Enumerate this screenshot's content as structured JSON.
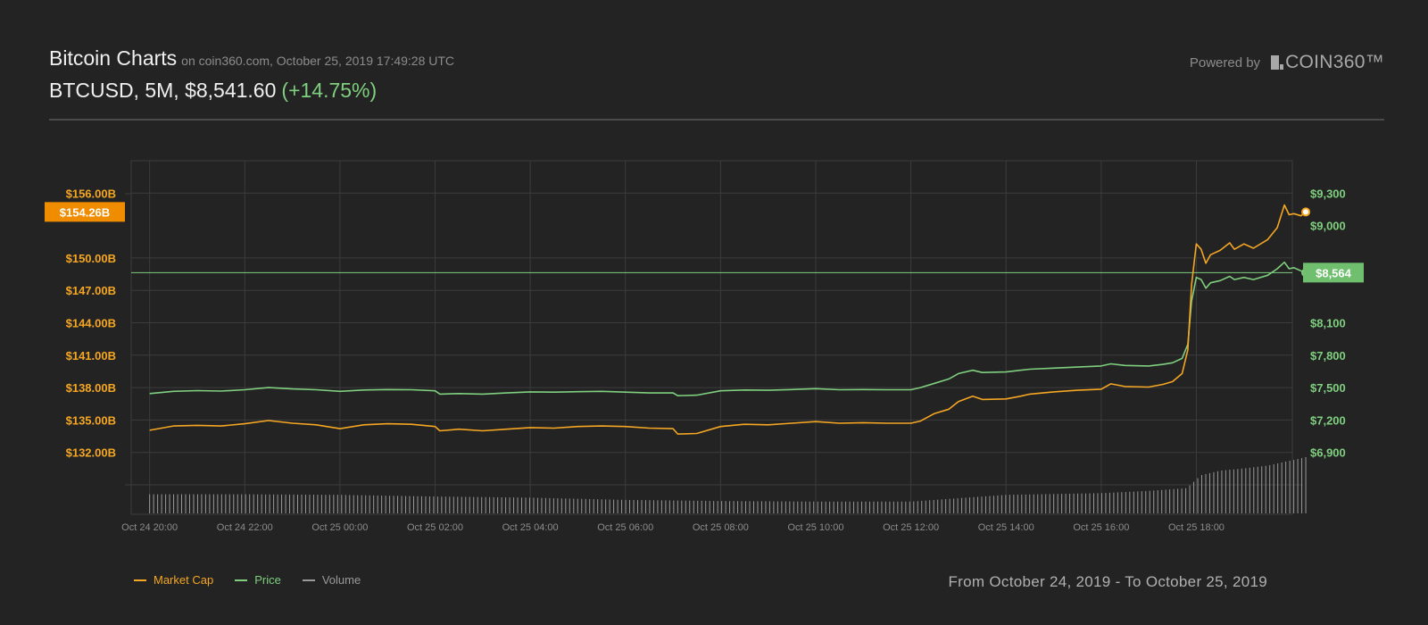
{
  "header": {
    "title": "Bitcoin Charts",
    "subtitle": "on coin360.com, October 25, 2019 17:49:28 UTC",
    "ticker": "BTCUSD, 5M, $8,541.60",
    "change": "(+14.75%)",
    "powered_by": "Powered by",
    "brand": "COIN360™"
  },
  "footer": {
    "date_range": "From October 24, 2019 - To October 25, 2019"
  },
  "colors": {
    "market_cap": "#f5a623",
    "price": "#7fcf7f",
    "volume": "#9a9a9a",
    "grid": "#3c3c3c",
    "badge_text": "#ffffff"
  },
  "chart_data": {
    "type": "line",
    "x_tick_labels": [
      "Oct 24 20:00",
      "Oct 24 22:00",
      "Oct 25 00:00",
      "Oct 25 02:00",
      "Oct 25 04:00",
      "Oct 25 06:00",
      "Oct 25 08:00",
      "Oct 25 10:00",
      "Oct 25 12:00",
      "Oct 25 14:00",
      "Oct 25 16:00",
      "Oct 25 18:00"
    ],
    "x_hours_range": [
      -4.2,
      19.83
    ],
    "left_axis": {
      "tick_values": [
        156,
        150,
        147,
        144,
        141,
        138,
        135,
        132
      ],
      "tick_labels": [
        "$156.00B",
        "$150.00B",
        "$147.00B",
        "$144.00B",
        "$141.00B",
        "$138.00B",
        "$135.00B",
        "$132.00B"
      ],
      "range": [
        129,
        159
      ],
      "current_label": "$154.26B",
      "current_value": 154.26
    },
    "right_axis": {
      "tick_values": [
        9300,
        9000,
        8100,
        7800,
        7500,
        7200,
        6900
      ],
      "tick_labels": [
        "$9,300",
        "$9,000",
        "$8,100",
        "$7,800",
        "$7,500",
        "$7,200",
        "$6,900"
      ],
      "range": [
        6600,
        9600
      ],
      "current_label": "$8,564",
      "current_value": 8564
    },
    "grid": true,
    "legend_position": "bottom-left",
    "series": [
      {
        "name": "Market Cap",
        "axis": "left",
        "points": [
          [
            -4,
            134.05
          ],
          [
            -3.5,
            134.45
          ],
          [
            -3,
            134.5
          ],
          [
            -2.5,
            134.45
          ],
          [
            -2,
            134.65
          ],
          [
            -1.5,
            134.95
          ],
          [
            -1,
            134.7
          ],
          [
            -0.5,
            134.55
          ],
          [
            0,
            134.2
          ],
          [
            0.5,
            134.55
          ],
          [
            1,
            134.65
          ],
          [
            1.5,
            134.6
          ],
          [
            2,
            134.4
          ],
          [
            2.1,
            134.0
          ],
          [
            2.5,
            134.15
          ],
          [
            3,
            134.0
          ],
          [
            3.5,
            134.15
          ],
          [
            4,
            134.3
          ],
          [
            4.5,
            134.25
          ],
          [
            5,
            134.4
          ],
          [
            5.5,
            134.45
          ],
          [
            6,
            134.4
          ],
          [
            6.5,
            134.25
          ],
          [
            7,
            134.2
          ],
          [
            7.1,
            133.7
          ],
          [
            7.5,
            133.75
          ],
          [
            8,
            134.4
          ],
          [
            8.5,
            134.6
          ],
          [
            9,
            134.55
          ],
          [
            9.5,
            134.7
          ],
          [
            10,
            134.85
          ],
          [
            10.5,
            134.7
          ],
          [
            11,
            134.75
          ],
          [
            11.5,
            134.7
          ],
          [
            12,
            134.7
          ],
          [
            12.2,
            134.9
          ],
          [
            12.5,
            135.6
          ],
          [
            12.8,
            136.0
          ],
          [
            13,
            136.7
          ],
          [
            13.3,
            137.2
          ],
          [
            13.5,
            136.9
          ],
          [
            14,
            136.95
          ],
          [
            14.3,
            137.2
          ],
          [
            14.5,
            137.4
          ],
          [
            15,
            137.6
          ],
          [
            15.5,
            137.75
          ],
          [
            16,
            137.85
          ],
          [
            16.2,
            138.35
          ],
          [
            16.5,
            138.1
          ],
          [
            17,
            138.05
          ],
          [
            17.3,
            138.3
          ],
          [
            17.5,
            138.55
          ],
          [
            17.7,
            139.3
          ],
          [
            17.82,
            141.5
          ],
          [
            17.9,
            147.5
          ],
          [
            18,
            151.3
          ],
          [
            18.1,
            150.8
          ],
          [
            18.2,
            149.5
          ],
          [
            18.3,
            150.3
          ],
          [
            18.5,
            150.7
          ],
          [
            18.7,
            151.4
          ],
          [
            18.8,
            150.8
          ],
          [
            19,
            151.3
          ],
          [
            19.2,
            150.9
          ],
          [
            19.5,
            151.7
          ],
          [
            19.7,
            152.8
          ],
          [
            19.85,
            154.9
          ],
          [
            19.95,
            154.0
          ],
          [
            20.05,
            154.1
          ],
          [
            20.2,
            153.9
          ],
          [
            20.3,
            154.26
          ]
        ]
      },
      {
        "name": "Price",
        "axis": "right",
        "points": [
          [
            -4,
            7445
          ],
          [
            -3.5,
            7465
          ],
          [
            -3,
            7472
          ],
          [
            -2.5,
            7468
          ],
          [
            -2,
            7480
          ],
          [
            -1.5,
            7500
          ],
          [
            -1,
            7488
          ],
          [
            -0.5,
            7480
          ],
          [
            0,
            7465
          ],
          [
            0.5,
            7478
          ],
          [
            1,
            7482
          ],
          [
            1.5,
            7480
          ],
          [
            2,
            7470
          ],
          [
            2.1,
            7440
          ],
          [
            2.5,
            7445
          ],
          [
            3,
            7440
          ],
          [
            3.5,
            7450
          ],
          [
            4,
            7460
          ],
          [
            4.5,
            7458
          ],
          [
            5,
            7462
          ],
          [
            5.5,
            7465
          ],
          [
            6,
            7458
          ],
          [
            6.5,
            7450
          ],
          [
            7,
            7450
          ],
          [
            7.1,
            7425
          ],
          [
            7.5,
            7430
          ],
          [
            8,
            7470
          ],
          [
            8.5,
            7478
          ],
          [
            9,
            7475
          ],
          [
            9.5,
            7482
          ],
          [
            10,
            7490
          ],
          [
            10.5,
            7480
          ],
          [
            11,
            7482
          ],
          [
            11.5,
            7480
          ],
          [
            12,
            7480
          ],
          [
            12.2,
            7500
          ],
          [
            12.5,
            7540
          ],
          [
            12.8,
            7580
          ],
          [
            13,
            7630
          ],
          [
            13.3,
            7660
          ],
          [
            13.5,
            7640
          ],
          [
            14,
            7645
          ],
          [
            14.3,
            7660
          ],
          [
            14.5,
            7670
          ],
          [
            15,
            7680
          ],
          [
            15.5,
            7690
          ],
          [
            16,
            7700
          ],
          [
            16.2,
            7720
          ],
          [
            16.5,
            7705
          ],
          [
            17,
            7700
          ],
          [
            17.3,
            7715
          ],
          [
            17.5,
            7730
          ],
          [
            17.7,
            7770
          ],
          [
            17.82,
            7900
          ],
          [
            17.9,
            8300
          ],
          [
            18,
            8520
          ],
          [
            18.1,
            8500
          ],
          [
            18.2,
            8420
          ],
          [
            18.3,
            8470
          ],
          [
            18.5,
            8490
          ],
          [
            18.7,
            8530
          ],
          [
            18.8,
            8500
          ],
          [
            19,
            8520
          ],
          [
            19.2,
            8500
          ],
          [
            19.5,
            8540
          ],
          [
            19.7,
            8600
          ],
          [
            19.85,
            8660
          ],
          [
            19.95,
            8600
          ],
          [
            20.05,
            8610
          ],
          [
            20.2,
            8580
          ],
          [
            20.3,
            8564
          ]
        ]
      },
      {
        "name": "Volume",
        "axis": "volume",
        "bar_count": 290,
        "level_points": [
          [
            -4,
            0.34
          ],
          [
            -2,
            0.34
          ],
          [
            0,
            0.33
          ],
          [
            2,
            0.3
          ],
          [
            4,
            0.28
          ],
          [
            6,
            0.24
          ],
          [
            7,
            0.23
          ],
          [
            8,
            0.22
          ],
          [
            10,
            0.21
          ],
          [
            12,
            0.21
          ],
          [
            13,
            0.27
          ],
          [
            14,
            0.33
          ],
          [
            16,
            0.36
          ],
          [
            17,
            0.4
          ],
          [
            17.8,
            0.45
          ],
          [
            18.1,
            0.68
          ],
          [
            18.5,
            0.76
          ],
          [
            19,
            0.8
          ],
          [
            19.5,
            0.85
          ],
          [
            20.3,
            1.0
          ]
        ]
      }
    ]
  }
}
